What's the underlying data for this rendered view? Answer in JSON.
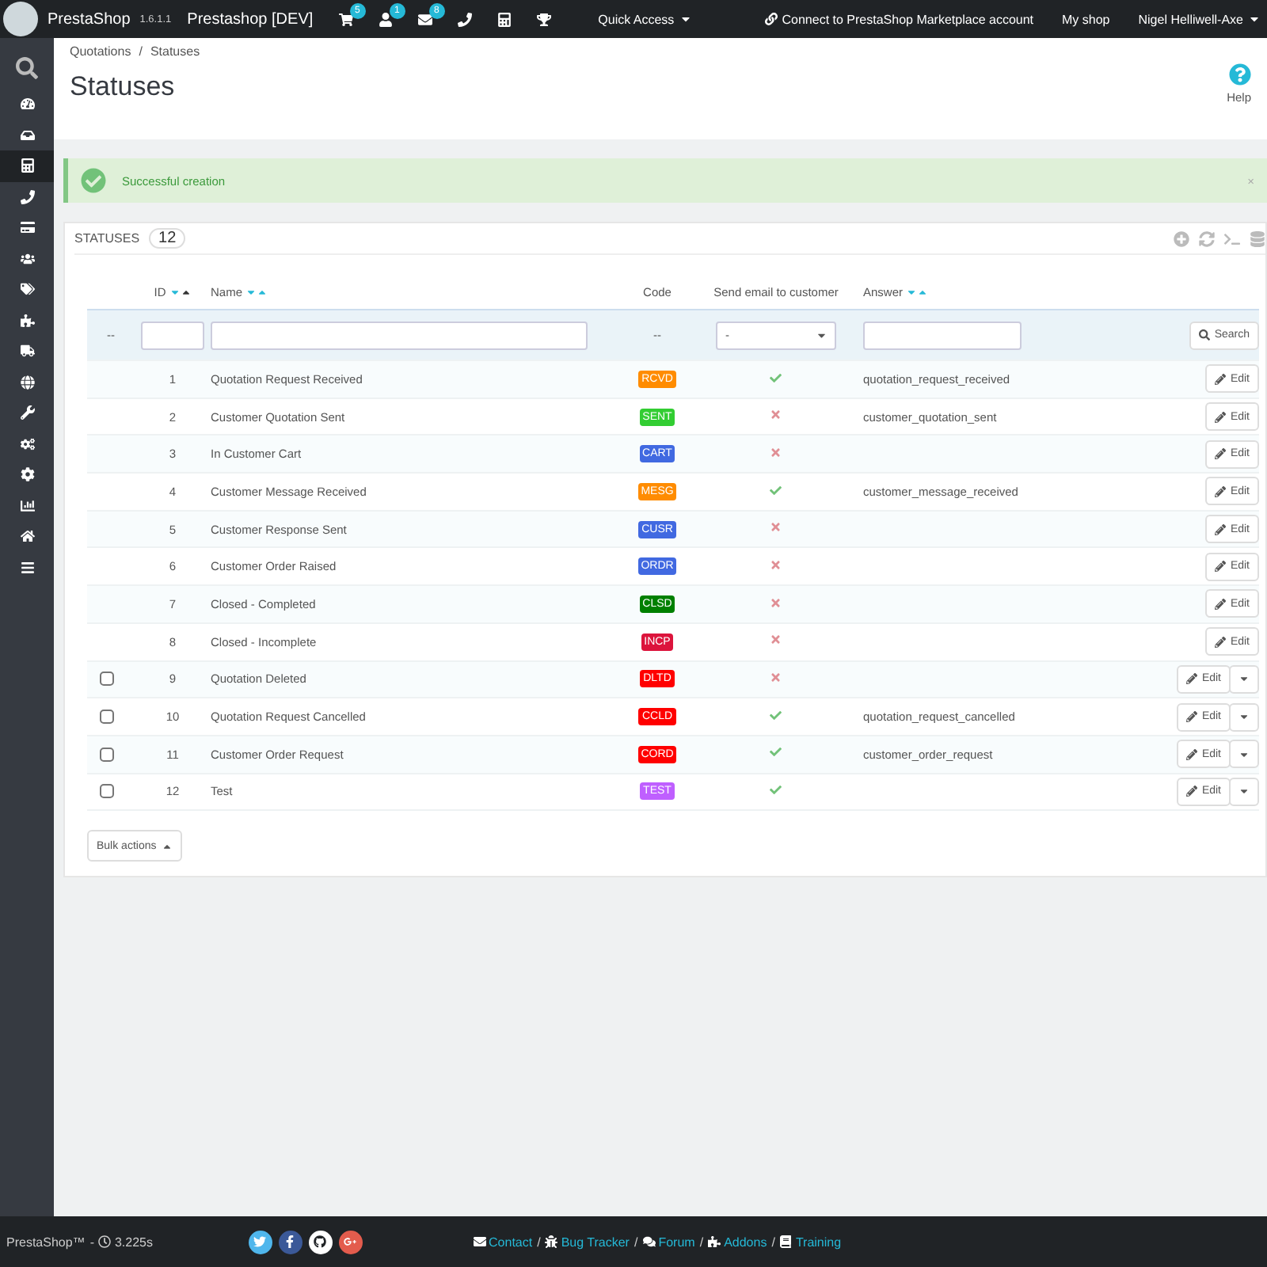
{
  "topbar": {
    "logo": "PrestaShop",
    "version": "1.6.1.1",
    "shop_name": "Prestashop [DEV]",
    "badges": [
      "5",
      "1",
      "8"
    ],
    "quick_access": "Quick Access",
    "marketplace": "Connect to PrestaShop Marketplace account",
    "my_shop": "My shop",
    "employee": "Nigel Helliwell-Axe"
  },
  "sidebar": {
    "items": [
      {
        "selected": false
      },
      {
        "selected": false
      },
      {
        "selected": true
      },
      {
        "selected": false
      },
      {
        "selected": false
      },
      {
        "selected": false
      },
      {
        "selected": false
      },
      {
        "selected": false
      },
      {
        "selected": false
      },
      {
        "selected": false
      },
      {
        "selected": false
      },
      {
        "selected": false
      },
      {
        "selected": false
      },
      {
        "selected": false
      },
      {
        "selected": false
      },
      {
        "selected": false
      }
    ]
  },
  "breadcrumb": {
    "parent": "Quotations",
    "separator": "/",
    "current": "Statuses"
  },
  "page_title": "Statuses",
  "help": "Help",
  "alert": {
    "message": "Successful creation",
    "close": "×"
  },
  "panel": {
    "title": "STATUSES",
    "count": "12",
    "columns": [
      {
        "label": "ID",
        "sortable": true
      },
      {
        "label": "Name",
        "sortable": true
      },
      {
        "label": "Code",
        "sortable": false
      },
      {
        "label": "Send email to customer",
        "sortable": false
      },
      {
        "label": "Answer",
        "sortable": true
      }
    ],
    "filters": {
      "bulk": "--",
      "code": "--",
      "email_select": "-",
      "search": "Search"
    },
    "rows": [
      {
        "kind": "locked",
        "id": "1",
        "name": "Quotation Request Received",
        "code": "RCVD",
        "color": "#ff8c00",
        "email": true,
        "answer": "quotation_request_received",
        "edit": "Edit"
      },
      {
        "kind": "locked",
        "id": "2",
        "name": "Customer Quotation Sent",
        "code": "SENT",
        "color": "#32cd32",
        "email": false,
        "answer": "customer_quotation_sent",
        "edit": "Edit"
      },
      {
        "kind": "locked",
        "id": "3",
        "name": "In Customer Cart",
        "code": "CART",
        "color": "#4169e1",
        "email": false,
        "edit": "Edit"
      },
      {
        "kind": "locked",
        "id": "4",
        "name": "Customer Message Received",
        "code": "MESG",
        "color": "#ff8c00",
        "email": true,
        "answer": "customer_message_received",
        "edit": "Edit"
      },
      {
        "kind": "locked",
        "id": "5",
        "name": "Customer Response Sent",
        "code": "CUSR",
        "color": "#4169e1",
        "email": false,
        "edit": "Edit"
      },
      {
        "kind": "locked",
        "id": "6",
        "name": "Customer Order Raised",
        "code": "ORDR",
        "color": "#4169e1",
        "email": false,
        "edit": "Edit"
      },
      {
        "kind": "locked",
        "id": "7",
        "name": "Closed - Completed",
        "code": "CLSD",
        "color": "#008000",
        "email": false,
        "edit": "Edit"
      },
      {
        "kind": "locked",
        "id": "8",
        "name": "Closed - Incomplete",
        "code": "INCP",
        "color": "#dc143c",
        "email": false,
        "edit": "Edit"
      },
      {
        "kind": "deletable",
        "checked": false,
        "id": "9",
        "name": "Quotation Deleted",
        "code": "DLTD",
        "color": "#ff0000",
        "email": false,
        "edit": "Edit"
      },
      {
        "kind": "deletable",
        "checked": false,
        "id": "10",
        "name": "Quotation Request Cancelled",
        "code": "CCLD",
        "color": "#ff0000",
        "email": true,
        "answer": "quotation_request_cancelled",
        "edit": "Edit"
      },
      {
        "kind": "deletable",
        "checked": false,
        "id": "11",
        "name": "Customer Order Request",
        "code": "CORD",
        "color": "#ff0000",
        "email": true,
        "answer": "customer_order_request",
        "edit": "Edit"
      },
      {
        "kind": "deletable",
        "checked": false,
        "id": "12",
        "name": "Test",
        "code": "TEST",
        "color": "#bf5fff",
        "email": true,
        "edit": "Edit"
      }
    ],
    "bulk_actions": "Bulk actions"
  },
  "footer": {
    "brand": "PrestaShop™",
    "dash": "-",
    "load_time": "3.225s",
    "links": [
      {
        "label": "Contact",
        "separator": "/"
      },
      {
        "label": "Bug Tracker",
        "separator": "/"
      },
      {
        "label": "Forum",
        "separator": "/"
      },
      {
        "label": "Addons",
        "separator": "/"
      },
      {
        "label": "Training"
      }
    ]
  }
}
